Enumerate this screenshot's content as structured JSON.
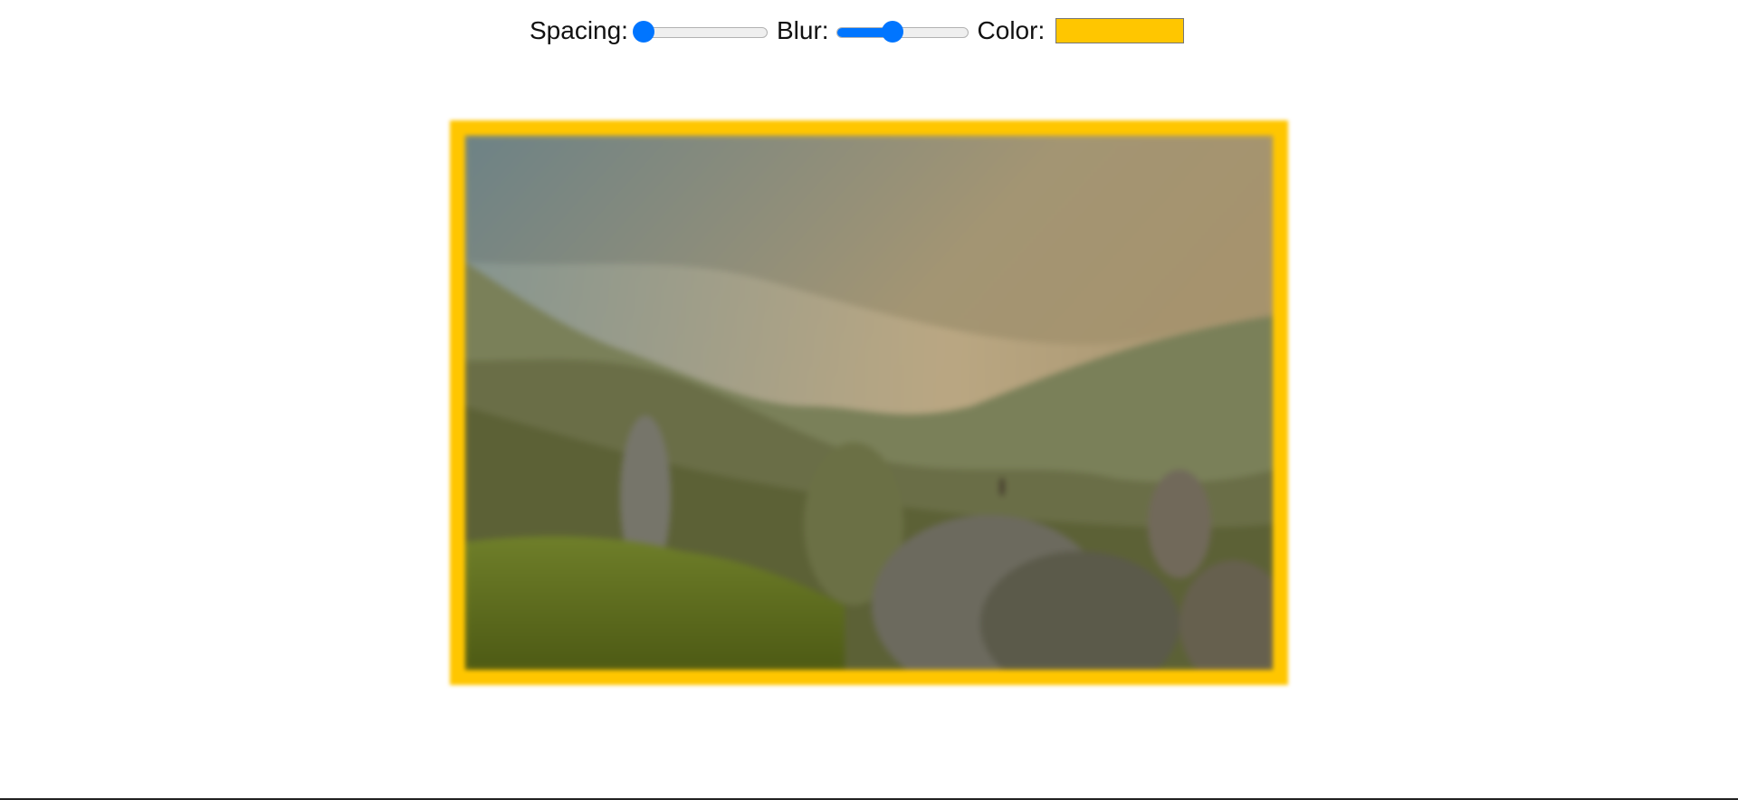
{
  "controls": {
    "spacing": {
      "label": "Spacing:",
      "value_fraction": 0.06
    },
    "blur": {
      "label": "Blur:",
      "value_fraction": 0.43
    },
    "color": {
      "label": "Color:",
      "value": "#ffc600"
    }
  },
  "colors": {
    "frame": "#ffc600",
    "accent": "#0075ff"
  },
  "image": {
    "subject": "blurred mountain landscape with rock spires and a lone figure"
  }
}
